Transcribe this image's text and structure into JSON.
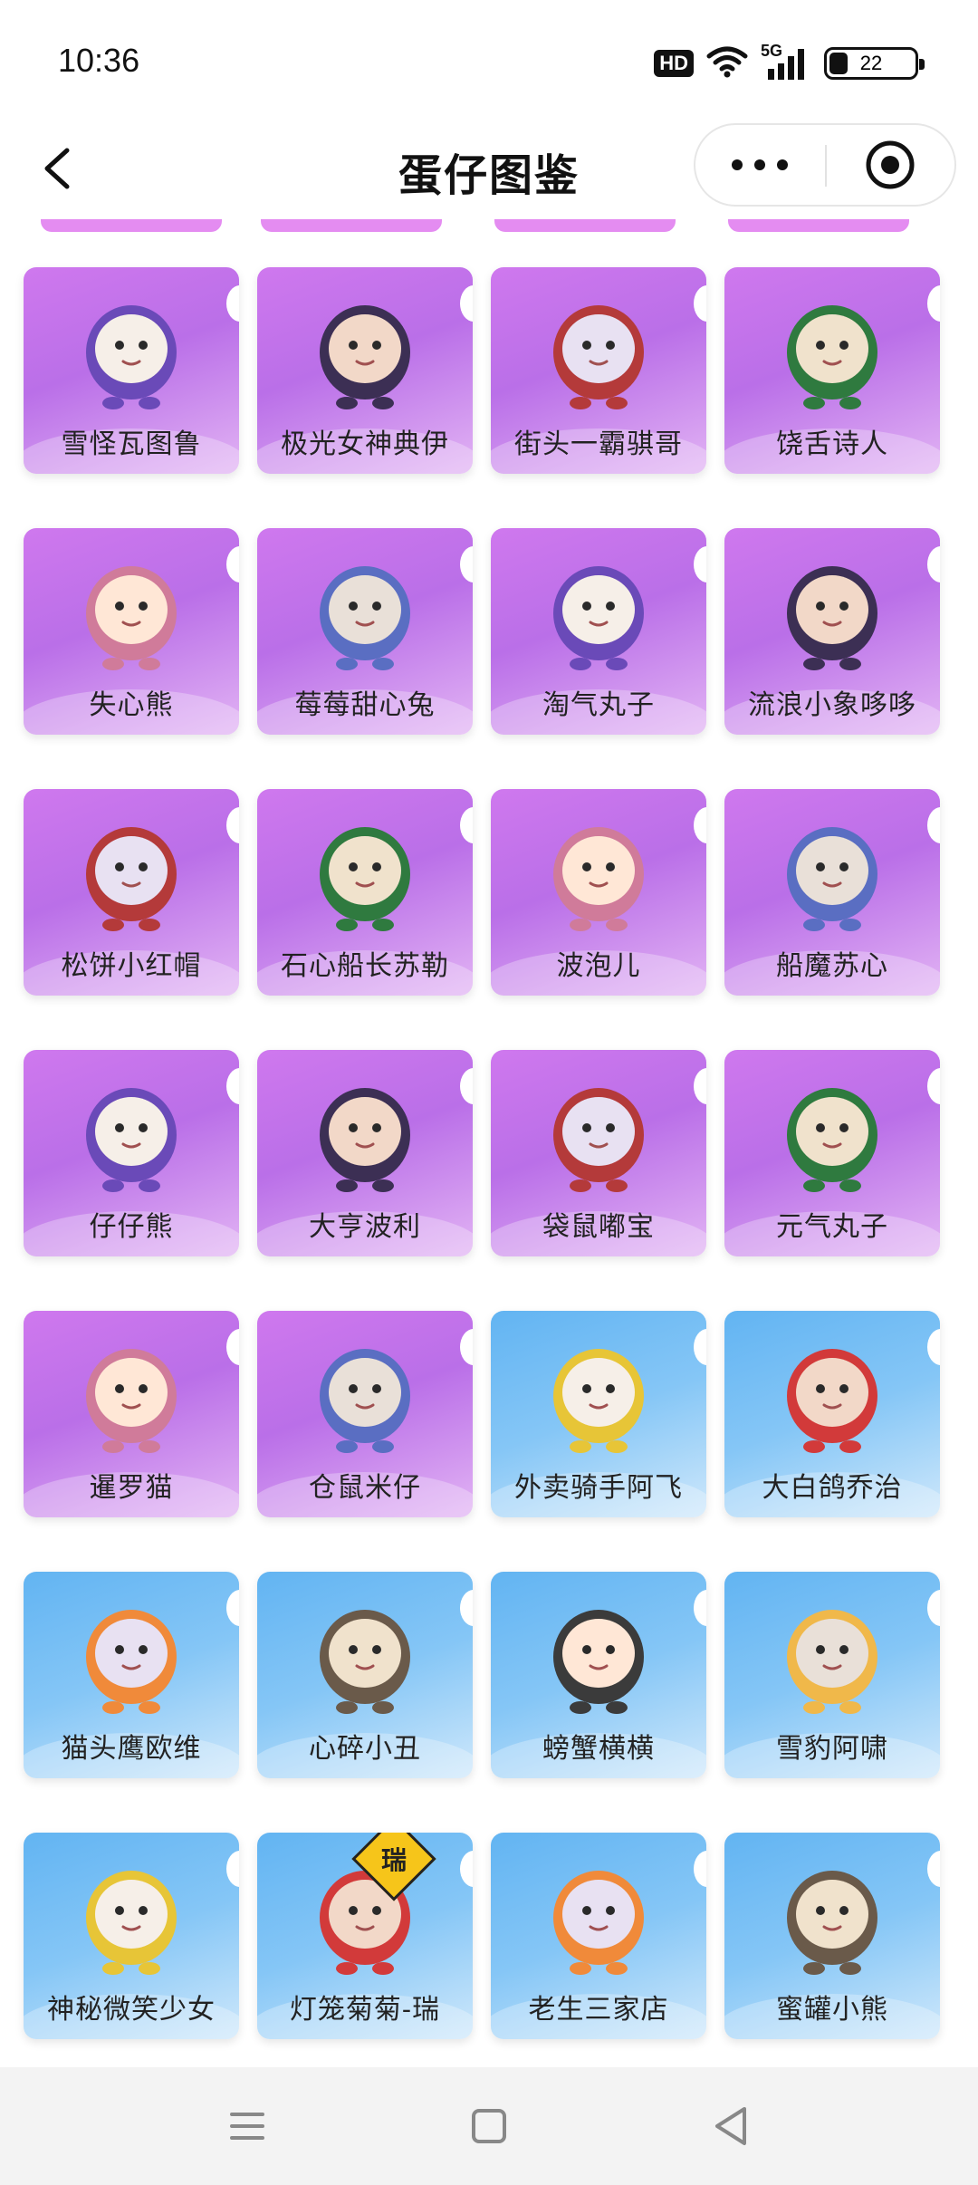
{
  "status_bar": {
    "time": "10:36",
    "hd": "HD",
    "network": "5G",
    "battery": "22",
    "battery_level": 0.22,
    "icons": [
      "wifi-icon",
      "signal-icon",
      "battery-icon"
    ]
  },
  "nav": {
    "title": "蛋仔图鉴",
    "icons": [
      "back-icon",
      "more-icon",
      "close-target-icon"
    ]
  },
  "colors": {
    "purple_card": "#cf78ee",
    "blue_card": "#62b4f2",
    "nav_bg": "#f3f3f3"
  },
  "characters": [
    {
      "name": "雪怪瓦图鲁",
      "theme": "purple"
    },
    {
      "name": "极光女神典伊",
      "theme": "purple"
    },
    {
      "name": "街头一霸骐哥",
      "theme": "purple"
    },
    {
      "name": "饶舌诗人",
      "theme": "purple"
    },
    {
      "name": "失心熊",
      "theme": "purple"
    },
    {
      "name": "莓莓甜心兔",
      "theme": "purple"
    },
    {
      "name": "淘气丸子",
      "theme": "purple"
    },
    {
      "name": "流浪小象哆哆",
      "theme": "purple"
    },
    {
      "name": "松饼小红帽",
      "theme": "purple"
    },
    {
      "name": "石心船长苏勒",
      "theme": "purple"
    },
    {
      "name": "波泡儿",
      "theme": "purple"
    },
    {
      "name": "船魔苏心",
      "theme": "purple"
    },
    {
      "name": "仔仔熊",
      "theme": "purple"
    },
    {
      "name": "大亨波利",
      "theme": "purple"
    },
    {
      "name": "袋鼠嘟宝",
      "theme": "purple"
    },
    {
      "name": "元气丸子",
      "theme": "purple"
    },
    {
      "name": "暹罗猫",
      "theme": "purple"
    },
    {
      "name": "仓鼠米仔",
      "theme": "purple"
    },
    {
      "name": "外卖骑手阿飞",
      "theme": "blue"
    },
    {
      "name": "大白鸽乔治",
      "theme": "blue"
    },
    {
      "name": "猫头鹰欧维",
      "theme": "blue"
    },
    {
      "name": "心碎小丑",
      "theme": "blue"
    },
    {
      "name": "螃蟹横横",
      "theme": "blue"
    },
    {
      "name": "雪豹阿啸",
      "theme": "blue"
    },
    {
      "name": "神秘微笑少女",
      "theme": "blue"
    },
    {
      "name": "灯笼菊菊-瑞",
      "theme": "blue",
      "badge": "瑞"
    },
    {
      "name": "老生三家店",
      "theme": "blue"
    },
    {
      "name": "蜜罐小熊",
      "theme": "blue"
    }
  ],
  "bottom_nav": {
    "icons": [
      "menu-icon",
      "home-icon",
      "back-triangle-icon"
    ]
  }
}
